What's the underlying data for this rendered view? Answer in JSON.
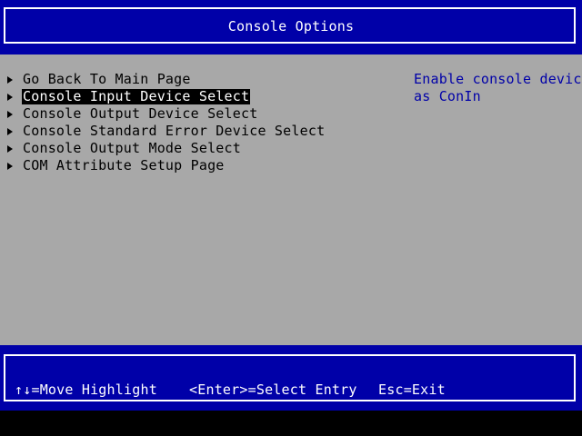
{
  "header": {
    "title": "Console Options"
  },
  "menu": {
    "items": [
      {
        "label": "Go Back To Main Page",
        "selected": false
      },
      {
        "label": "Console Input Device Select",
        "selected": true
      },
      {
        "label": "Console Output Device Select",
        "selected": false
      },
      {
        "label": "Console Standard Error Device Select",
        "selected": false
      },
      {
        "label": "Console Output Mode Select",
        "selected": false
      },
      {
        "label": "COM Attribute Setup Page",
        "selected": false
      }
    ]
  },
  "help": {
    "lines": [
      "Enable console device",
      "as ConIn"
    ]
  },
  "footer": {
    "move_hint": "↑↓=Move Highlight",
    "enter_hint": "<Enter>=Select Entry",
    "esc_hint": "Esc=Exit"
  },
  "colors": {
    "background": "#a8a8a8",
    "bar": "#0000a8",
    "help_text": "#0000a8",
    "highlight_bg": "#000000",
    "highlight_fg": "#ffffff"
  }
}
